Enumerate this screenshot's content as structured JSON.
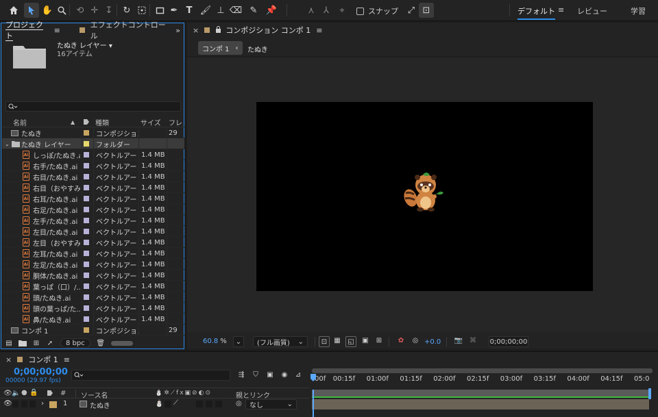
{
  "toolbar": {
    "snap_label": "スナップ",
    "workspaces": [
      "デフォルト",
      "レビュー",
      "学習"
    ],
    "workspace_menu_icon": "≡"
  },
  "project": {
    "tab_label": "プロジェクト",
    "tab_menu": "≡",
    "effects_tab_label": "エフェクトコントロール",
    "more": "»",
    "selected_name": "たぬき レイヤー ▾",
    "item_count": "16アイテム",
    "columns": {
      "name": "名前",
      "type": "種類",
      "size": "サイズ",
      "frame": "フレ"
    },
    "rows": [
      {
        "name": "たぬき",
        "type": "コンポジション",
        "size": "",
        "frame": "29",
        "kind": "comp",
        "indent": 0,
        "color": "#c8a560"
      },
      {
        "name": "たぬき レイヤー",
        "type": "フォルダー",
        "size": "",
        "frame": "",
        "kind": "folder",
        "indent": 0,
        "color": "#e6d96a"
      },
      {
        "name": "しっぽ/たぬき.ai",
        "type": "ベクトルアート",
        "size": "1.4 MB",
        "frame": "",
        "kind": "ai",
        "indent": 1,
        "color": "#b9b2d8"
      },
      {
        "name": "右手/たぬき.ai",
        "type": "ベクトルアート",
        "size": "1.4 MB",
        "frame": "",
        "kind": "ai",
        "indent": 1,
        "color": "#b9b2d8"
      },
      {
        "name": "右目/たぬき.ai",
        "type": "ベクトルアート",
        "size": "1.4 MB",
        "frame": "",
        "kind": "ai",
        "indent": 1,
        "color": "#b9b2d8"
      },
      {
        "name": "右目（おやすみ...",
        "type": "ベクトルアート",
        "size": "1.4 MB",
        "frame": "",
        "kind": "ai",
        "indent": 1,
        "color": "#b9b2d8"
      },
      {
        "name": "右耳/たぬき.ai",
        "type": "ベクトルアート",
        "size": "1.4 MB",
        "frame": "",
        "kind": "ai",
        "indent": 1,
        "color": "#b9b2d8"
      },
      {
        "name": "右足/たぬき.ai",
        "type": "ベクトルアート",
        "size": "1.4 MB",
        "frame": "",
        "kind": "ai",
        "indent": 1,
        "color": "#b9b2d8"
      },
      {
        "name": "左手/たぬき.ai",
        "type": "ベクトルアート",
        "size": "1.4 MB",
        "frame": "",
        "kind": "ai",
        "indent": 1,
        "color": "#b9b2d8"
      },
      {
        "name": "左目/たぬき.ai",
        "type": "ベクトルアート",
        "size": "1.4 MB",
        "frame": "",
        "kind": "ai",
        "indent": 1,
        "color": "#b9b2d8"
      },
      {
        "name": "左目（おやすみ...",
        "type": "ベクトルアート",
        "size": "1.4 MB",
        "frame": "",
        "kind": "ai",
        "indent": 1,
        "color": "#b9b2d8"
      },
      {
        "name": "左耳/たぬき.ai",
        "type": "ベクトルアート",
        "size": "1.4 MB",
        "frame": "",
        "kind": "ai",
        "indent": 1,
        "color": "#b9b2d8"
      },
      {
        "name": "左足/たぬき.ai",
        "type": "ベクトルアート",
        "size": "1.4 MB",
        "frame": "",
        "kind": "ai",
        "indent": 1,
        "color": "#b9b2d8"
      },
      {
        "name": "胴体/たぬき.ai",
        "type": "ベクトルアート",
        "size": "1.4 MB",
        "frame": "",
        "kind": "ai",
        "indent": 1,
        "color": "#b9b2d8"
      },
      {
        "name": "葉っぱ（口）/...ai",
        "type": "ベクトルアート",
        "size": "1.4 MB",
        "frame": "",
        "kind": "ai",
        "indent": 1,
        "color": "#b9b2d8"
      },
      {
        "name": "頭/たぬき.ai",
        "type": "ベクトルアート",
        "size": "1.4 MB",
        "frame": "",
        "kind": "ai",
        "indent": 1,
        "color": "#b9b2d8"
      },
      {
        "name": "頭の葉っぱ/た...i",
        "type": "ベクトルアート",
        "size": "1.4 MB",
        "frame": "",
        "kind": "ai",
        "indent": 1,
        "color": "#b9b2d8"
      },
      {
        "name": "鼻/たぬき.ai",
        "type": "ベクトルアート",
        "size": "1.4 MB",
        "frame": "",
        "kind": "ai",
        "indent": 1,
        "color": "#b9b2d8"
      },
      {
        "name": "コンポ 1",
        "type": "コンポジション",
        "size": "",
        "frame": "29",
        "kind": "comp",
        "indent": 0,
        "color": "#c8a560"
      }
    ],
    "bpc": "8 bpc"
  },
  "comp": {
    "tab_label": "コンポジション コンポ 1",
    "tab_menu": "≡",
    "crumb1": "コンポ 1",
    "crumb_sep": "‹",
    "crumb2": "たぬき",
    "zoom": "60.8",
    "zoom_unit": "%",
    "quality": "(フル画質)",
    "exposure": "+0.0",
    "timecode": "0;00;00;00"
  },
  "timeline": {
    "tab_label": "コンポ 1",
    "tab_menu": "≡",
    "timecode": "0;00;00;00",
    "fps": "00000 (29.97 fps)",
    "col_num": "#",
    "col_source": "ソース名",
    "col_parent": "親とリンク",
    "layer_num": "1",
    "layer_name": "たぬき",
    "parent_value": "なし",
    "ruler": [
      "00f",
      "00:15f",
      "01:00f",
      "01:15f",
      "02:00f",
      "02:15f",
      "03:00f",
      "03:15f",
      "04:00f",
      "04:15f",
      "05:0"
    ]
  },
  "colors": {
    "accent": "#2d8ceb",
    "track_green": "#3fb83f",
    "layer_bar": "#6b6356"
  }
}
